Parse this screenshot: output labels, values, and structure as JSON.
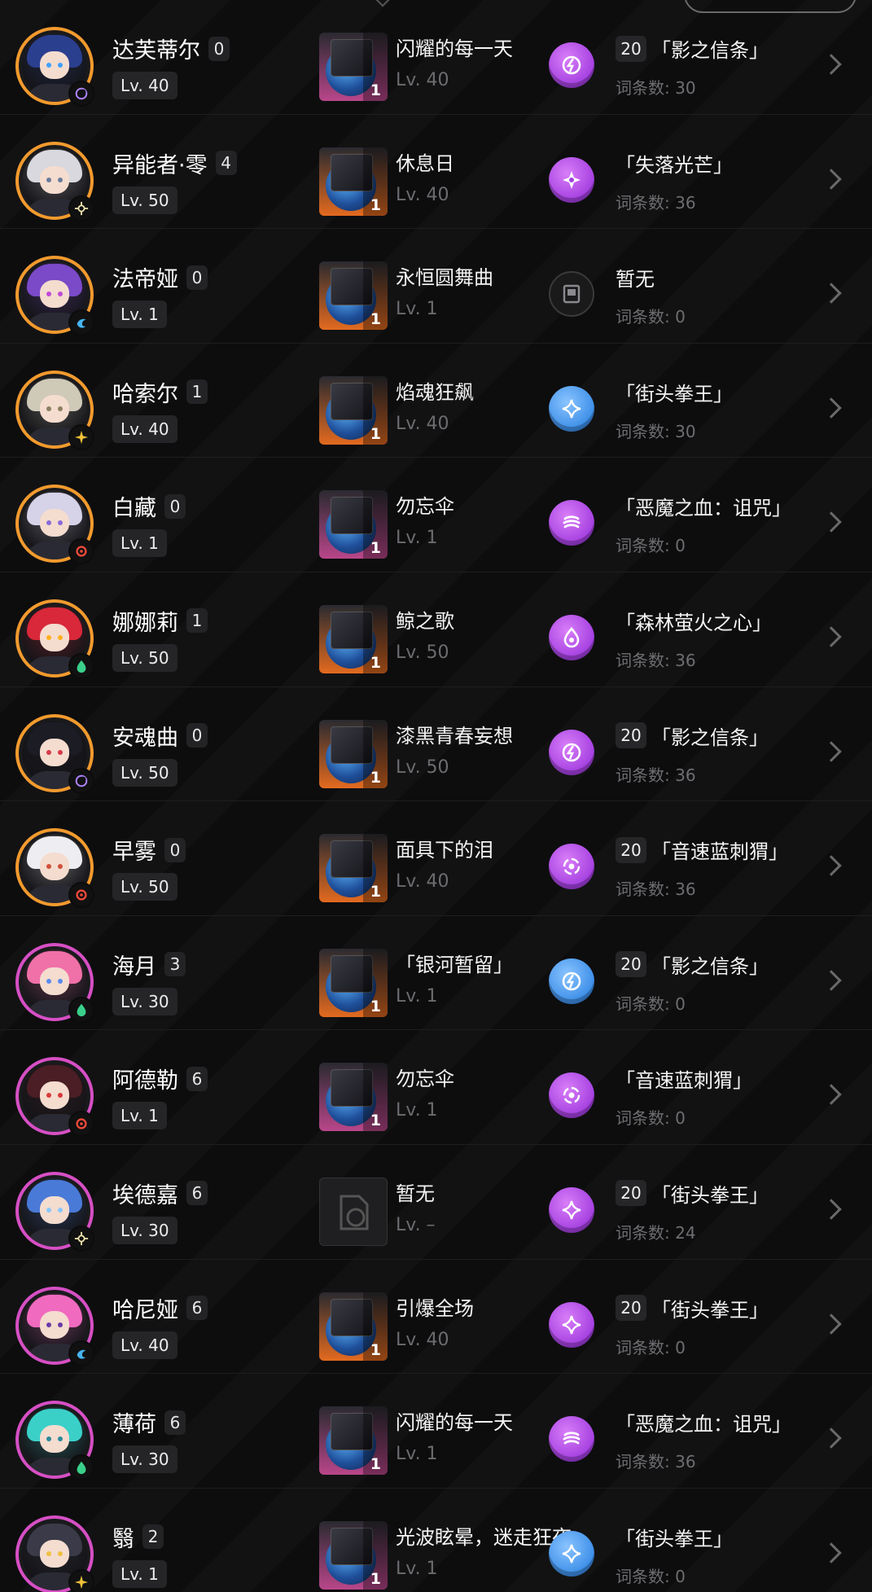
{
  "colors": {
    "rank_s_ring": "#d64fc4",
    "rank_a_ring": "#f29a2e",
    "set_purple": "#a43fe0",
    "set_blue": "#3c8ee8",
    "background": "#0d0d0e"
  },
  "rows": [
    {
      "name": "达芙蒂尔",
      "mindscape": "0",
      "level": "Lv. 40",
      "ring": "a",
      "hair": "#2b3f8f",
      "eye": "#3fa0ff",
      "element": "ether-icon",
      "engine": {
        "name": "闪耀的每一天",
        "level": "Lv. 40",
        "rank": "s",
        "ref": "1"
      },
      "set": {
        "count": "20",
        "name": "「影之信条」",
        "substat": "词条数: 30",
        "style": "purple",
        "glyph": "shadow-icon"
      }
    },
    {
      "name": "异能者·零",
      "mindscape": "4",
      "level": "Lv. 50",
      "ring": "a",
      "hair": "#d8d8de",
      "eye": "#6a7a9a",
      "element": "physical-icon",
      "engine": {
        "name": "休息日",
        "level": "Lv. 40",
        "rank": "a",
        "ref": "1"
      },
      "set": {
        "count": "",
        "name": "「失落光芒」",
        "substat": "词条数: 36",
        "style": "purple",
        "glyph": "star-icon"
      }
    },
    {
      "name": "法帝娅",
      "mindscape": "0",
      "level": "Lv. 1",
      "ring": "a",
      "hair": "#7a4ac8",
      "eye": "#c04ad8",
      "element": "ice-icon",
      "engine": {
        "name": "永恒圆舞曲",
        "level": "Lv. 1",
        "rank": "a",
        "ref": "1"
      },
      "set": {
        "count": "",
        "name": "暂无",
        "substat": "词条数: 0",
        "style": "empty",
        "glyph": "empty-disc-icon"
      }
    },
    {
      "name": "哈索尔",
      "mindscape": "1",
      "level": "Lv. 40",
      "ring": "a",
      "hair": "#cfc9b8",
      "eye": "#8a7f60",
      "element": "electric-icon",
      "engine": {
        "name": "焰魂狂飙",
        "level": "Lv. 40",
        "rank": "a",
        "ref": "1"
      },
      "set": {
        "count": "",
        "name": "「街头拳王」",
        "substat": "词条数: 30",
        "style": "blue",
        "glyph": "sparkle-icon"
      }
    },
    {
      "name": "白藏",
      "mindscape": "0",
      "level": "Lv. 1",
      "ring": "a",
      "hair": "#d6d2e8",
      "eye": "#8a6ad8",
      "element": "fire-icon",
      "engine": {
        "name": "勿忘伞",
        "level": "Lv. 1",
        "rank": "s",
        "ref": "1"
      },
      "set": {
        "count": "",
        "name": "「恶魔之血：诅咒」",
        "substat": "词条数: 0",
        "style": "purple",
        "glyph": "flame-icon"
      }
    },
    {
      "name": "娜娜莉",
      "mindscape": "1",
      "level": "Lv. 50",
      "ring": "a",
      "hair": "#d8283a",
      "eye": "#ffb020",
      "element": "wind-icon",
      "engine": {
        "name": "鲸之歌",
        "level": "Lv. 50",
        "rank": "a",
        "ref": "1"
      },
      "set": {
        "count": "",
        "name": "「森林萤火之心」",
        "substat": "词条数: 36",
        "style": "purple",
        "glyph": "drop-icon"
      }
    },
    {
      "name": "安魂曲",
      "mindscape": "0",
      "level": "Lv. 50",
      "ring": "a",
      "hair": "#1c1c24",
      "eye": "#d83a4a",
      "element": "ether-icon",
      "engine": {
        "name": "漆黑青春妄想",
        "level": "Lv. 50",
        "rank": "a",
        "ref": "1"
      },
      "set": {
        "count": "20",
        "name": "「影之信条」",
        "substat": "词条数: 36",
        "style": "purple",
        "glyph": "shadow-icon"
      }
    },
    {
      "name": "早雾",
      "mindscape": "0",
      "level": "Lv. 50",
      "ring": "a",
      "hair": "#eeeef2",
      "eye": "#d0503a",
      "element": "fire-icon",
      "engine": {
        "name": "面具下的泪",
        "level": "Lv. 40",
        "rank": "a",
        "ref": "1"
      },
      "set": {
        "count": "20",
        "name": "「音速蓝刺猬」",
        "substat": "词条数: 36",
        "style": "purple",
        "glyph": "target-icon"
      }
    },
    {
      "name": "海月",
      "mindscape": "3",
      "level": "Lv. 30",
      "ring": "s",
      "hair": "#f070a8",
      "eye": "#5a8af0",
      "element": "wind-icon",
      "engine": {
        "name": "「银河暂留」",
        "level": "Lv. 1",
        "rank": "a",
        "ref": "1"
      },
      "set": {
        "count": "20",
        "name": "「影之信条」",
        "substat": "词条数: 0",
        "style": "blue",
        "glyph": "shadow-icon"
      }
    },
    {
      "name": "阿德勒",
      "mindscape": "6",
      "level": "Lv. 1",
      "ring": "s",
      "hair": "#4a1e24",
      "eye": "#d83a3a",
      "element": "fire-icon",
      "engine": {
        "name": "勿忘伞",
        "level": "Lv. 1",
        "rank": "s",
        "ref": "1"
      },
      "set": {
        "count": "",
        "name": "「音速蓝刺猬」",
        "substat": "词条数: 0",
        "style": "purple",
        "glyph": "target-icon"
      }
    },
    {
      "name": "埃德嘉",
      "mindscape": "6",
      "level": "Lv. 30",
      "ring": "s",
      "hair": "#4a7ad8",
      "eye": "#8ac8ff",
      "element": "physical-icon",
      "engine": {
        "name": "暂无",
        "level": "Lv. –",
        "rank": "none",
        "ref": ""
      },
      "set": {
        "count": "20",
        "name": "「街头拳王」",
        "substat": "词条数: 24",
        "style": "purple",
        "glyph": "sparkle-icon"
      }
    },
    {
      "name": "哈尼娅",
      "mindscape": "6",
      "level": "Lv. 40",
      "ring": "s",
      "hair": "#f06ac0",
      "eye": "#6a3aa8",
      "element": "ice-icon",
      "engine": {
        "name": "引爆全场",
        "level": "Lv. 40",
        "rank": "a",
        "ref": "1"
      },
      "set": {
        "count": "20",
        "name": "「街头拳王」",
        "substat": "词条数: 0",
        "style": "purple",
        "glyph": "sparkle-icon"
      }
    },
    {
      "name": "薄荷",
      "mindscape": "6",
      "level": "Lv. 30",
      "ring": "s",
      "hair": "#3ad0c8",
      "eye": "#2a8a9a",
      "element": "wind-icon",
      "engine": {
        "name": "闪耀的每一天",
        "level": "Lv. 1",
        "rank": "s",
        "ref": "1"
      },
      "set": {
        "count": "",
        "name": "「恶魔之血：诅咒」",
        "substat": "词条数: 36",
        "style": "purple",
        "glyph": "flame-icon"
      }
    },
    {
      "name": "翳",
      "mindscape": "2",
      "level": "Lv. 1",
      "ring": "s",
      "hair": "#3a3a48",
      "eye": "#f0c040",
      "element": "electric-icon",
      "engine": {
        "name": "光波眩晕，迷走狂夜",
        "level": "Lv. 1",
        "rank": "s",
        "ref": "1"
      },
      "set": {
        "count": "",
        "name": "「街头拳王」",
        "substat": "词条数: 0",
        "style": "blue",
        "glyph": "sparkle-icon"
      }
    }
  ]
}
